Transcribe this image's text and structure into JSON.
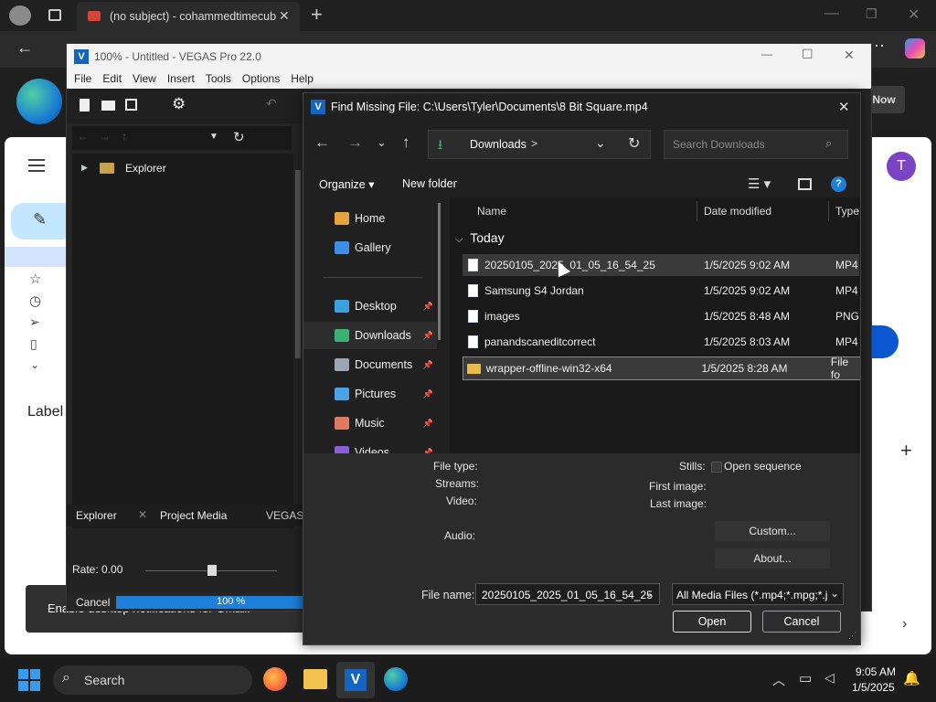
{
  "browser": {
    "tab_title": "(no subject) - cohammedtimecub",
    "new_tab": "+",
    "gmail_label": "Label",
    "notify_text": "Enable desktop notifications for Gmail.",
    "now_button": "Now",
    "avatar_letter": "T"
  },
  "vegas": {
    "title": "100% - Untitled - VEGAS Pro 22.0",
    "menu": [
      "File",
      "Edit",
      "View",
      "Insert",
      "Tools",
      "Options",
      "Help"
    ],
    "explorer_root": "Explorer",
    "tabs": {
      "explorer": "Explorer",
      "project_media": "Project Media",
      "vegas": "VEGAS"
    },
    "rate_label": "Rate: 0.00",
    "cancel_label": "Cancel",
    "progress_text": "100 %",
    "progress_value": 1.0
  },
  "dialog": {
    "title": "Find Missing File: C:\\Users\\Tyler\\Documents\\8 Bit Square.mp4",
    "breadcrumb": "Downloads",
    "breadcrumb_sep": ">",
    "search_placeholder": "Search Downloads",
    "organize": "Organize",
    "new_folder": "New folder",
    "nav": [
      {
        "label": "Home",
        "pinned": false,
        "color": "#e8a33d"
      },
      {
        "label": "Gallery",
        "pinned": false,
        "color": "#3d8ee8"
      },
      {
        "label": "Desktop",
        "pinned": true,
        "color": "#3aa0e0"
      },
      {
        "label": "Downloads",
        "pinned": true,
        "color": "#3bb272"
      },
      {
        "label": "Documents",
        "pinned": true,
        "color": "#9aa6b2"
      },
      {
        "label": "Pictures",
        "pinned": true,
        "color": "#4aa3e8"
      },
      {
        "label": "Music",
        "pinned": true,
        "color": "#e07a5f"
      },
      {
        "label": "Videos",
        "pinned": true,
        "color": "#8a5fd6"
      }
    ],
    "columns": {
      "name": "Name",
      "date": "Date modified",
      "type": "Type"
    },
    "group": "Today",
    "files": [
      {
        "name": "20250105_2025_01_05_16_54_25",
        "date": "1/5/2025 9:02 AM",
        "type": "MP4",
        "kind": "file",
        "selected": true
      },
      {
        "name": "Samsung S4 Jordan",
        "date": "1/5/2025 9:02 AM",
        "type": "MP4",
        "kind": "file",
        "selected": false
      },
      {
        "name": "images",
        "date": "1/5/2025 8:48 AM",
        "type": "PNG",
        "kind": "file",
        "selected": false
      },
      {
        "name": "panandscaneditcorrect",
        "date": "1/5/2025 8:03 AM",
        "type": "MP4",
        "kind": "file",
        "selected": false
      },
      {
        "name": "wrapper-offline-win32-x64",
        "date": "1/5/2025 8:28 AM",
        "type": "File fo",
        "kind": "folder",
        "selected": true
      }
    ],
    "info": {
      "file_type": "File type:",
      "streams": "Streams:",
      "video": "Video:",
      "audio": "Audio:",
      "stills": "Stills:",
      "open_sequence": "Open sequence",
      "first_image": "First image:",
      "last_image": "Last image:",
      "custom": "Custom...",
      "about": "About..."
    },
    "file_name_label": "File name:",
    "file_name_value": "20250105_2025_01_05_16_54_25",
    "filter_value": "All Media Files (*.mp4;*.mpg;*.j",
    "open_button": "Open",
    "cancel_button": "Cancel"
  },
  "taskbar": {
    "search": "Search",
    "time": "9:05 AM",
    "date": "1/5/2025"
  },
  "colors": {
    "accent": "#1e7fd8",
    "vegas_blue": "#1565c0",
    "selected_row": "#3a3a3a"
  }
}
